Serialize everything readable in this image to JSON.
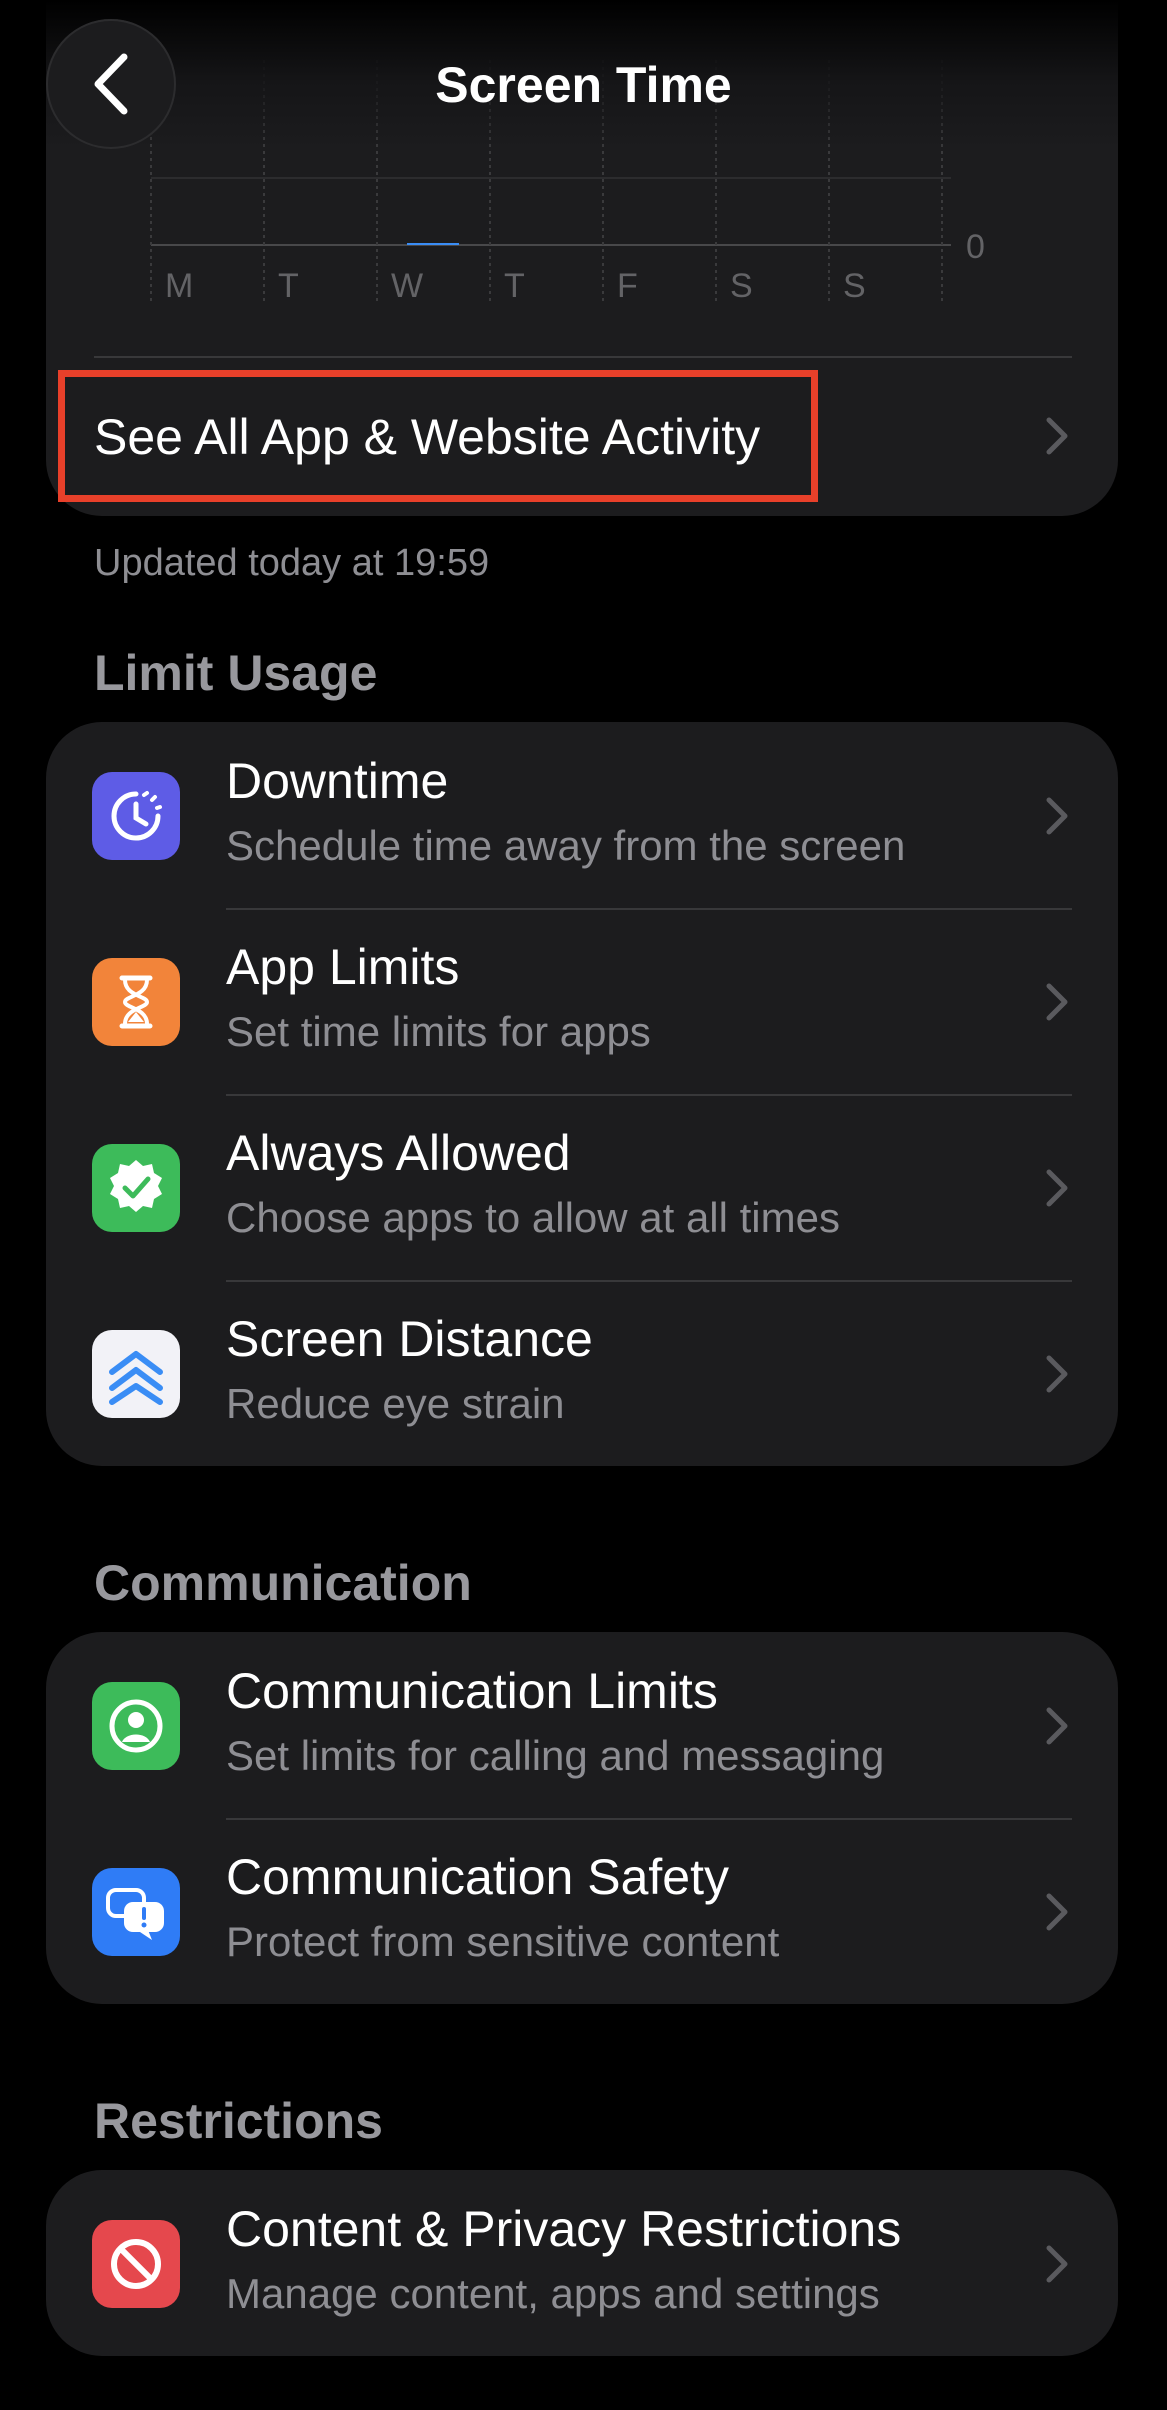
{
  "header": {
    "title": "Screen Time"
  },
  "chart_data": {
    "type": "bar",
    "categories": [
      "M",
      "T",
      "W",
      "T",
      "F",
      "S",
      "S"
    ],
    "values": [
      0,
      0,
      0,
      0,
      0,
      0,
      0
    ],
    "title": "",
    "xlabel": "",
    "ylabel": "",
    "yticks": [
      "0"
    ],
    "ylim": [
      0,
      1
    ],
    "grid": true
  },
  "activity": {
    "see_all_label": "See All App & Website Activity",
    "updated_text": "Updated today at 19:59"
  },
  "limit_usage": {
    "title": "Limit Usage",
    "items": [
      {
        "label": "Downtime",
        "subtitle": "Schedule time away from the screen",
        "icon": "downtime-icon",
        "color": "#5e5ce6"
      },
      {
        "label": "App Limits",
        "subtitle": "Set time limits for apps",
        "icon": "hourglass-icon",
        "color": "#f2843a"
      },
      {
        "label": "Always Allowed",
        "subtitle": "Choose apps to allow at all times",
        "icon": "checkmark-seal-icon",
        "color": "#3dbb5a"
      },
      {
        "label": "Screen Distance",
        "subtitle": "Reduce eye strain",
        "icon": "chevrons-up-icon",
        "color": "#f2f2f7"
      }
    ]
  },
  "communication": {
    "title": "Communication",
    "items": [
      {
        "label": "Communication Limits",
        "subtitle": "Set limits for calling and messaging",
        "icon": "person-circle-icon",
        "color": "#3dbb5a"
      },
      {
        "label": "Communication Safety",
        "subtitle": "Protect from sensitive content",
        "icon": "chat-bubbles-icon",
        "color": "#2f7cf6"
      }
    ]
  },
  "restrictions": {
    "title": "Restrictions",
    "items": [
      {
        "label": "Content & Privacy Restrictions",
        "subtitle": "Manage content, apps and settings",
        "icon": "prohibited-icon",
        "color": "#e5484d"
      }
    ]
  }
}
